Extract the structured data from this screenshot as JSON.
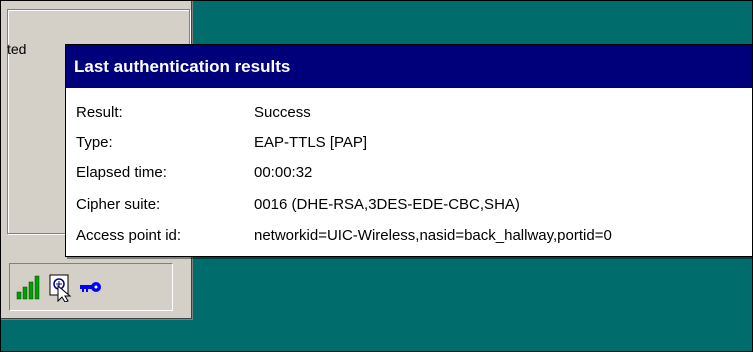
{
  "window": {
    "status_fragment": "ted"
  },
  "tray": {
    "icons": [
      {
        "name": "signal-strength-icon",
        "color": "#00a000"
      },
      {
        "name": "authentication-status-icon",
        "color": "#000000"
      },
      {
        "name": "key-icon",
        "color": "#0000ff"
      }
    ]
  },
  "tooltip": {
    "title": "Last authentication results",
    "rows": [
      {
        "label": "Result:",
        "value": "Success"
      },
      {
        "label": "Type:",
        "value": "EAP-TTLS [PAP]"
      },
      {
        "label": "Elapsed time:",
        "value": "00:00:32"
      },
      {
        "label": "Cipher suite:",
        "value": "0016 (DHE-RSA,3DES-EDE-CBC,SHA)"
      },
      {
        "label": "Access point id:",
        "value": "networkid=UIC-Wireless,nasid=back_hallway,portid=0"
      }
    ]
  },
  "colors": {
    "desktop": "#006c6c",
    "title_bar": "#00007b"
  }
}
